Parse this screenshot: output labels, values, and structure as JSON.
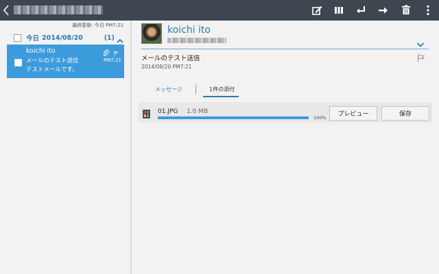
{
  "topbar": {
    "account_title": "",
    "icons": [
      "back-icon",
      "compose-icon",
      "split-view-icon",
      "reply-icon",
      "forward-icon",
      "delete-icon",
      "more-icon"
    ],
    "color": "#3e4750"
  },
  "list": {
    "sync_status": "最終更新: 今日 PM7:21",
    "group": {
      "label": "今日",
      "date": "2014/08/20",
      "count": "(1)"
    },
    "items": [
      {
        "sender": "koichi ito",
        "subject": "メールのテスト送信",
        "preview": "テストメールです。",
        "time": "PM7:21",
        "has_attachment": true,
        "selected": true
      }
    ],
    "accent": "#3c9bdb"
  },
  "message": {
    "sender_name": "koichi ito",
    "sender_address": "",
    "subject": "メールのテスト送信",
    "datetime": "2014/08/20  PM7:21",
    "tabs": [
      {
        "label": "メッセージ",
        "active": false
      },
      {
        "label": "1件の添付",
        "active": true
      }
    ],
    "attachment": {
      "name": "01.JPG",
      "size": "1.0 MB",
      "progress": 1.0,
      "progress_text": "100%",
      "preview_label": "プレビュー",
      "save_label": "保存"
    },
    "link_color": "#2a7ab0"
  }
}
